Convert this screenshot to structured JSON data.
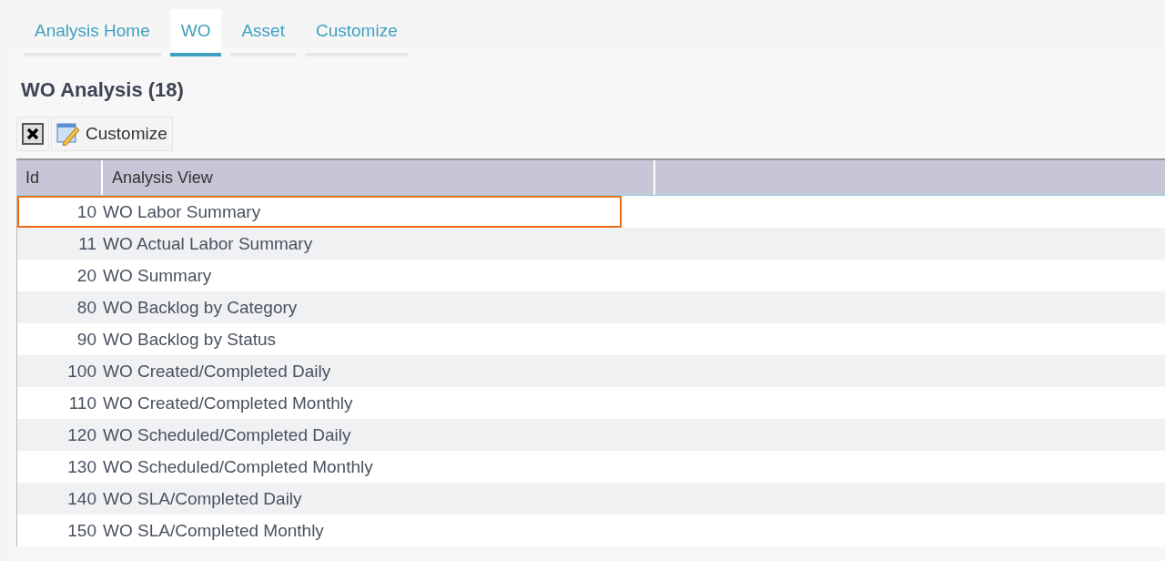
{
  "tabs": [
    {
      "label": "Analysis Home",
      "selected": false
    },
    {
      "label": "WO",
      "selected": true
    },
    {
      "label": "Asset",
      "selected": false
    },
    {
      "label": "Customize",
      "selected": false
    }
  ],
  "page_title": "WO Analysis (18)",
  "toolbar": {
    "customize_button": "Customize"
  },
  "table": {
    "columns": [
      "Id",
      "Analysis View"
    ],
    "rows": [
      {
        "id": "10",
        "view": "WO Labor Summary",
        "selected": true
      },
      {
        "id": "11",
        "view": "WO Actual Labor Summary",
        "selected": false
      },
      {
        "id": "20",
        "view": "WO Summary",
        "selected": false
      },
      {
        "id": "80",
        "view": "WO Backlog by Category",
        "selected": false
      },
      {
        "id": "90",
        "view": "WO Backlog by Status",
        "selected": false
      },
      {
        "id": "100",
        "view": "WO Created/Completed Daily",
        "selected": false
      },
      {
        "id": "110",
        "view": "WO Created/Completed Monthly",
        "selected": false
      },
      {
        "id": "120",
        "view": "WO Scheduled/Completed Daily",
        "selected": false
      },
      {
        "id": "130",
        "view": "WO Scheduled/Completed Monthly",
        "selected": false
      },
      {
        "id": "140",
        "view": "WO SLA/Completed Daily",
        "selected": false
      },
      {
        "id": "150",
        "view": "WO SLA/Completed Monthly",
        "selected": false
      }
    ]
  }
}
